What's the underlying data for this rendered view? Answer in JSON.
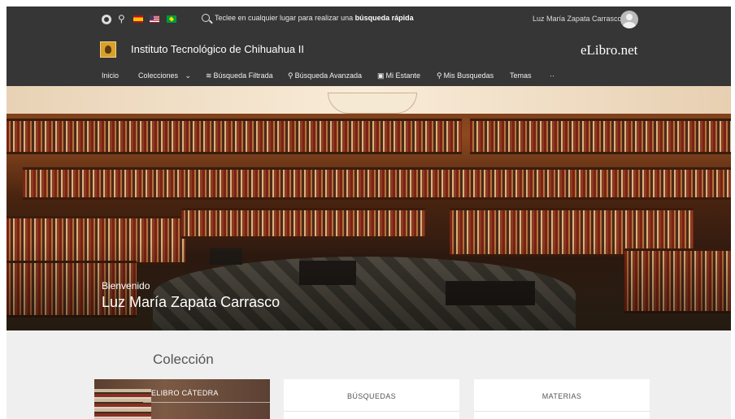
{
  "topbar": {
    "quick_search_prefix": "Teclee en cualquier lugar para realizar una ",
    "quick_search_bold": "búsqueda rápida",
    "user_name": "Luz María Zapata Carrasco"
  },
  "institution": {
    "name": "Instituto Tecnológico de Chihuahua II",
    "brand": "eLibro.net"
  },
  "nav": {
    "items": [
      {
        "label": "Inicio"
      },
      {
        "label": "Colecciones"
      },
      {
        "label": "Búsqueda Filtrada"
      },
      {
        "label": "Búsqueda Avanzada"
      },
      {
        "label": "Mi Estante"
      },
      {
        "label": "Mis Busquedas"
      },
      {
        "label": "Temas"
      },
      {
        "label": "··"
      }
    ]
  },
  "hero": {
    "greeting": "Bienvenido",
    "user_name": "Luz María Zapata Carrasco"
  },
  "collection": {
    "title": "Colección",
    "cards": [
      {
        "label": "ELIBRO CÁTEDRA"
      },
      {
        "label": "BÚSQUEDAS"
      },
      {
        "label": "MATERIAS"
      }
    ]
  }
}
